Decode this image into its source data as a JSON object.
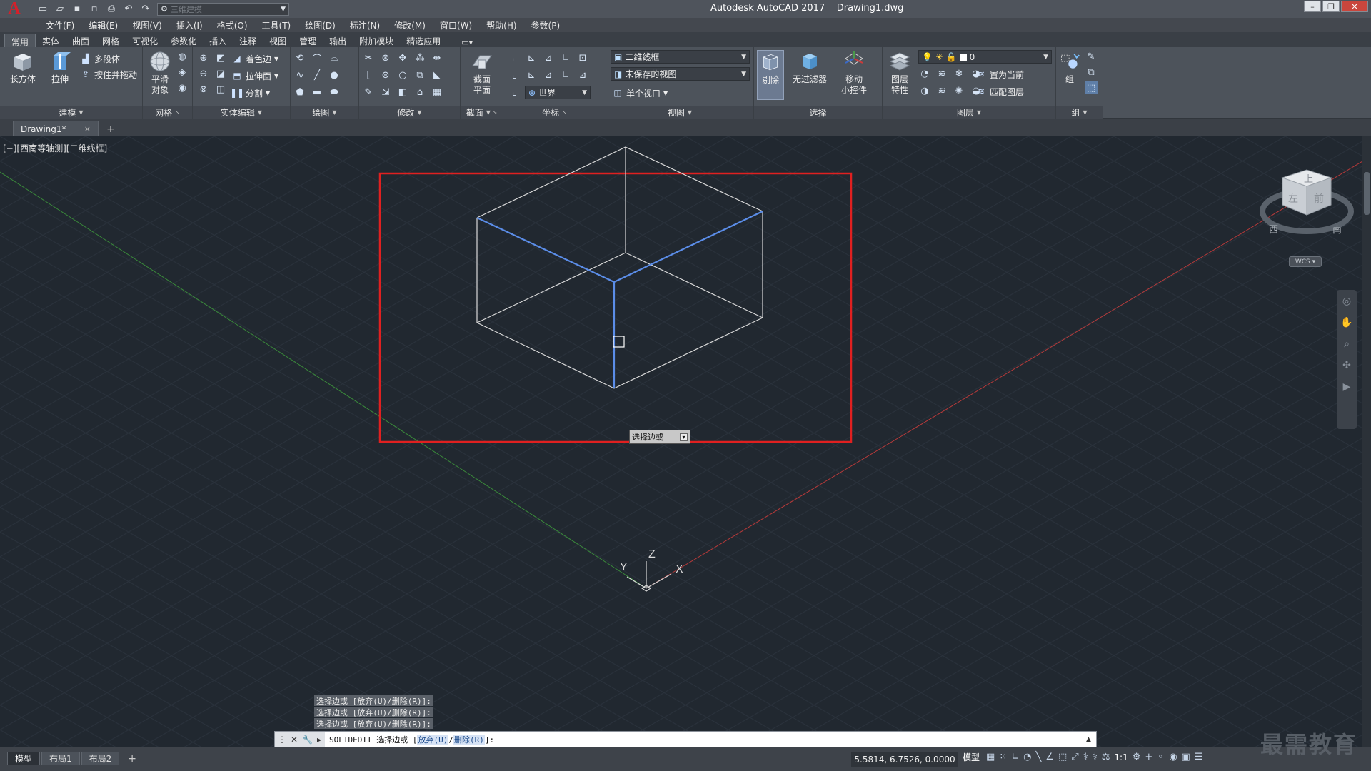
{
  "app": {
    "title": "Autodesk AutoCAD 2017    Drawing1.dwg",
    "logo": "A",
    "workspace": "三维建模"
  },
  "menu": [
    "文件(F)",
    "编辑(E)",
    "视图(V)",
    "插入(I)",
    "格式(O)",
    "工具(T)",
    "绘图(D)",
    "标注(N)",
    "修改(M)",
    "窗口(W)",
    "帮助(H)",
    "参数(P)"
  ],
  "ribbon_tabs": [
    "常用",
    "实体",
    "曲面",
    "网格",
    "可视化",
    "参数化",
    "插入",
    "注释",
    "视图",
    "管理",
    "输出",
    "附加模块",
    "精选应用"
  ],
  "ribbon": {
    "modeling": {
      "title": "建模",
      "box": "长方体",
      "extrude": "拉伸",
      "polysolid": "多段体",
      "presspull": "按住并拖动"
    },
    "mesh": {
      "title": "网格",
      "smooth": "平滑\n对象"
    },
    "solid_edit": {
      "title": "实体编辑",
      "color_edges": "着色边",
      "extrude_face": "拉伸面",
      "separate": "分割"
    },
    "draw": {
      "title": "绘图"
    },
    "modify": {
      "title": "修改"
    },
    "section": {
      "title": "截面",
      "plane": "截面\n平面"
    },
    "coords": {
      "title": "坐标",
      "world": "世界"
    },
    "view": {
      "title": "视图",
      "visual_style": "二维线框",
      "saved_view": "未保存的视图",
      "viewport": "单个视口"
    },
    "selection": {
      "title": "选择",
      "cull": "剔除",
      "no_filter": "无过滤器",
      "gizmo": "移动\n小控件"
    },
    "layers": {
      "title": "图层",
      "layer_props": "图层\n特性",
      "current_layer": "0",
      "set_current": "置为当前",
      "match_layer": "匹配图层"
    },
    "groups": {
      "title": "组",
      "group": "组"
    }
  },
  "doc_tab": {
    "label": "Drawing1*",
    "close": "×"
  },
  "viewport": {
    "label": "[−][西南等轴测][二维线框]",
    "tooltip": "选择边或",
    "viewcube": {
      "top": "上",
      "left": "左",
      "front": "前",
      "west": "西",
      "south": "南"
    },
    "wcs": "WCS ▾",
    "ucs": {
      "x": "X",
      "y": "Y",
      "z": "Z"
    }
  },
  "command": {
    "history": [
      "选择边或 [放弃(U)/删除(R)]:",
      "选择边或 [放弃(U)/删除(R)]:",
      "选择边或 [放弃(U)/删除(R)]:"
    ],
    "prompt_prefix": "SOLIDEDIT 选择边或 [",
    "opt_undo": "放弃(U)",
    "opt_remove": "删除(R)",
    "prompt_suffix": "]:"
  },
  "status": {
    "layouts": [
      "模型",
      "布局1",
      "布局2"
    ],
    "coords": "5.5814, 6.7526, 0.0000",
    "model": "模型",
    "scale": "1:1"
  },
  "watermark": "最需教育",
  "colors": {
    "background": "#212830",
    "highlight_box": "#e02020",
    "selected_edge": "#5b8de8",
    "wire": "#d9d9d9",
    "x_axis": "#b83a3a",
    "y_axis": "#3a8a3a"
  }
}
